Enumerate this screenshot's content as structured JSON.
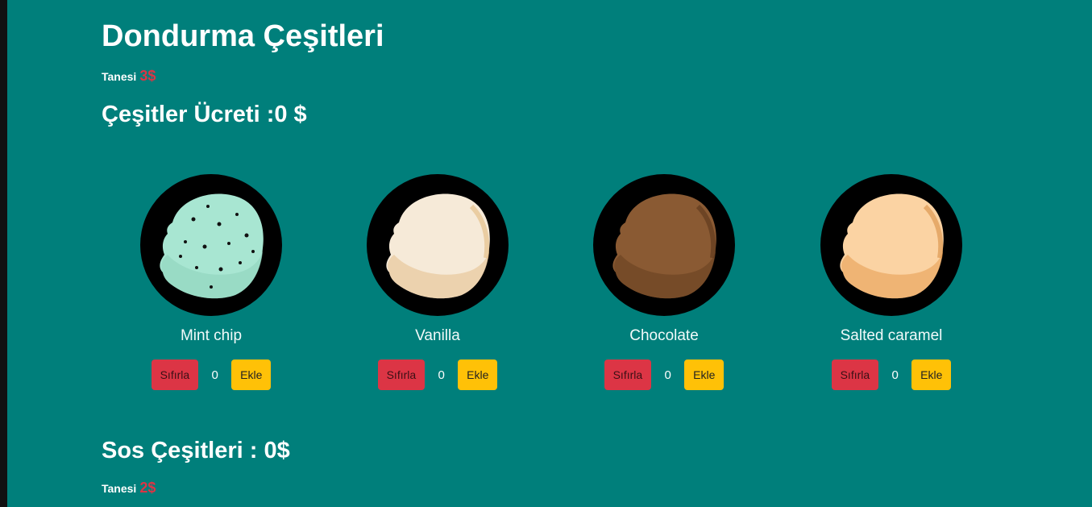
{
  "header": {
    "title": "Dondurma Çeşitleri",
    "unit_label": "Tanesi",
    "unit_price": "3$"
  },
  "flavors_total": {
    "label": "Çeşitler Ücreti :0 $"
  },
  "flavors": [
    {
      "name": "Mint chip",
      "count": "0",
      "reset_label": "Sıfırla",
      "add_label": "Ekle",
      "color": "#a8e6d2"
    },
    {
      "name": "Vanilla",
      "count": "0",
      "reset_label": "Sıfırla",
      "add_label": "Ekle",
      "color": "#f6ead8"
    },
    {
      "name": "Chocolate",
      "count": "0",
      "reset_label": "Sıfırla",
      "add_label": "Ekle",
      "color": "#8a5a33"
    },
    {
      "name": "Salted caramel",
      "count": "0",
      "reset_label": "Sıfırla",
      "add_label": "Ekle",
      "color": "#fbd3a3"
    }
  ],
  "sauces": {
    "title": "Sos Çeşitleri : 0$",
    "unit_label": "Tanesi",
    "unit_price": "2$"
  },
  "colors": {
    "background": "#007f7b",
    "reset_button": "#dc3545",
    "add_button": "#ffc107",
    "price": "#dc3545"
  }
}
